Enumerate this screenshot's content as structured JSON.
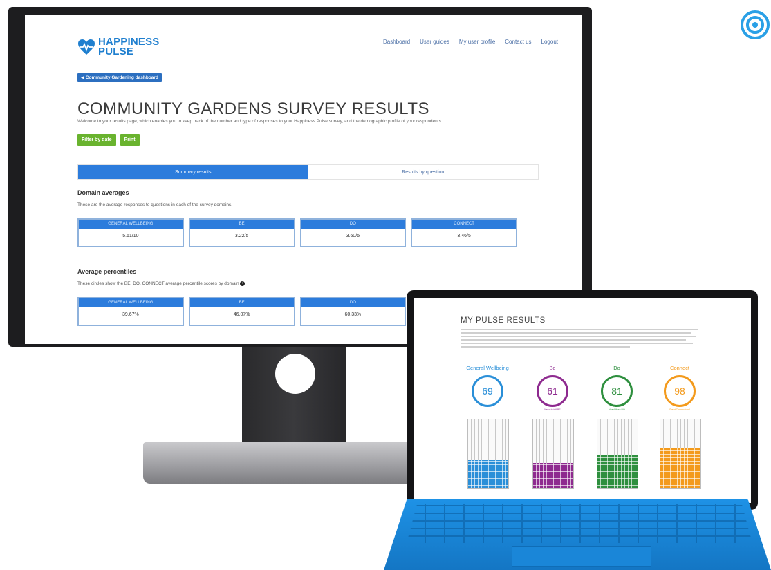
{
  "monitor_page": {
    "logo": {
      "line1": "HAPPINESS",
      "line2": "PULSE"
    },
    "nav": [
      "Dashboard",
      "User guides",
      "My user profile",
      "Contact us",
      "Logout"
    ],
    "breadcrumb": "◀ Community Gardening dashboard",
    "title": "COMMUNITY GARDENS SURVEY RESULTS",
    "intro": "Welcome to your results page, which enables you to keep track of the number and type of responses to your Happiness Pulse survey, and the demographic profile of your respondents.",
    "buttons": [
      "Filter by date",
      "Print"
    ],
    "tabs": [
      "Summary results",
      "Results by question"
    ],
    "domain_averages": {
      "title": "Domain averages",
      "subtitle": "These are the average responses to questions in each of the survey domains.",
      "cards": [
        {
          "label": "GENERAL WELLBEING",
          "value": "5.61/10"
        },
        {
          "label": "BE",
          "value": "3.22/5"
        },
        {
          "label": "DO",
          "value": "3.60/5"
        },
        {
          "label": "CONNECT",
          "value": "3.46/5"
        }
      ]
    },
    "average_percentiles": {
      "title": "Average percentiles",
      "subtitle": "These circles show the BE, DO, CONNECT average percentile scores by domain",
      "cards": [
        {
          "label": "GENERAL WELLBEING",
          "value": "39.67%"
        },
        {
          "label": "BE",
          "value": "46.07%"
        },
        {
          "label": "DO",
          "value": "60.33%"
        }
      ]
    }
  },
  "tablet_page": {
    "title": "MY PULSE RESULTS",
    "gauges": [
      {
        "label": "General Wellbeing",
        "value": "69",
        "color": "#2a8fd8",
        "fill_fraction": 0.69,
        "note": ""
      },
      {
        "label": "Be",
        "value": "61",
        "color": "#8e2a8f",
        "fill_fraction": 0.61,
        "note": "Need to tell BE"
      },
      {
        "label": "Do",
        "value": "81",
        "color": "#2e8f3e",
        "fill_fraction": 0.81,
        "note": "Need More DO"
      },
      {
        "label": "Connect",
        "value": "98",
        "color": "#f39a1c",
        "fill_fraction": 0.98,
        "note": "Great Connections!"
      }
    ]
  },
  "icons": {
    "corner": "target-icon",
    "logo": "pulse-logo-icon",
    "info": "info-icon"
  },
  "colors": {
    "brand_blue": "#1f7fcf",
    "accent_blue": "#2c7cdc",
    "green": "#69b32e",
    "laptop_blue": "#1b88dc"
  }
}
